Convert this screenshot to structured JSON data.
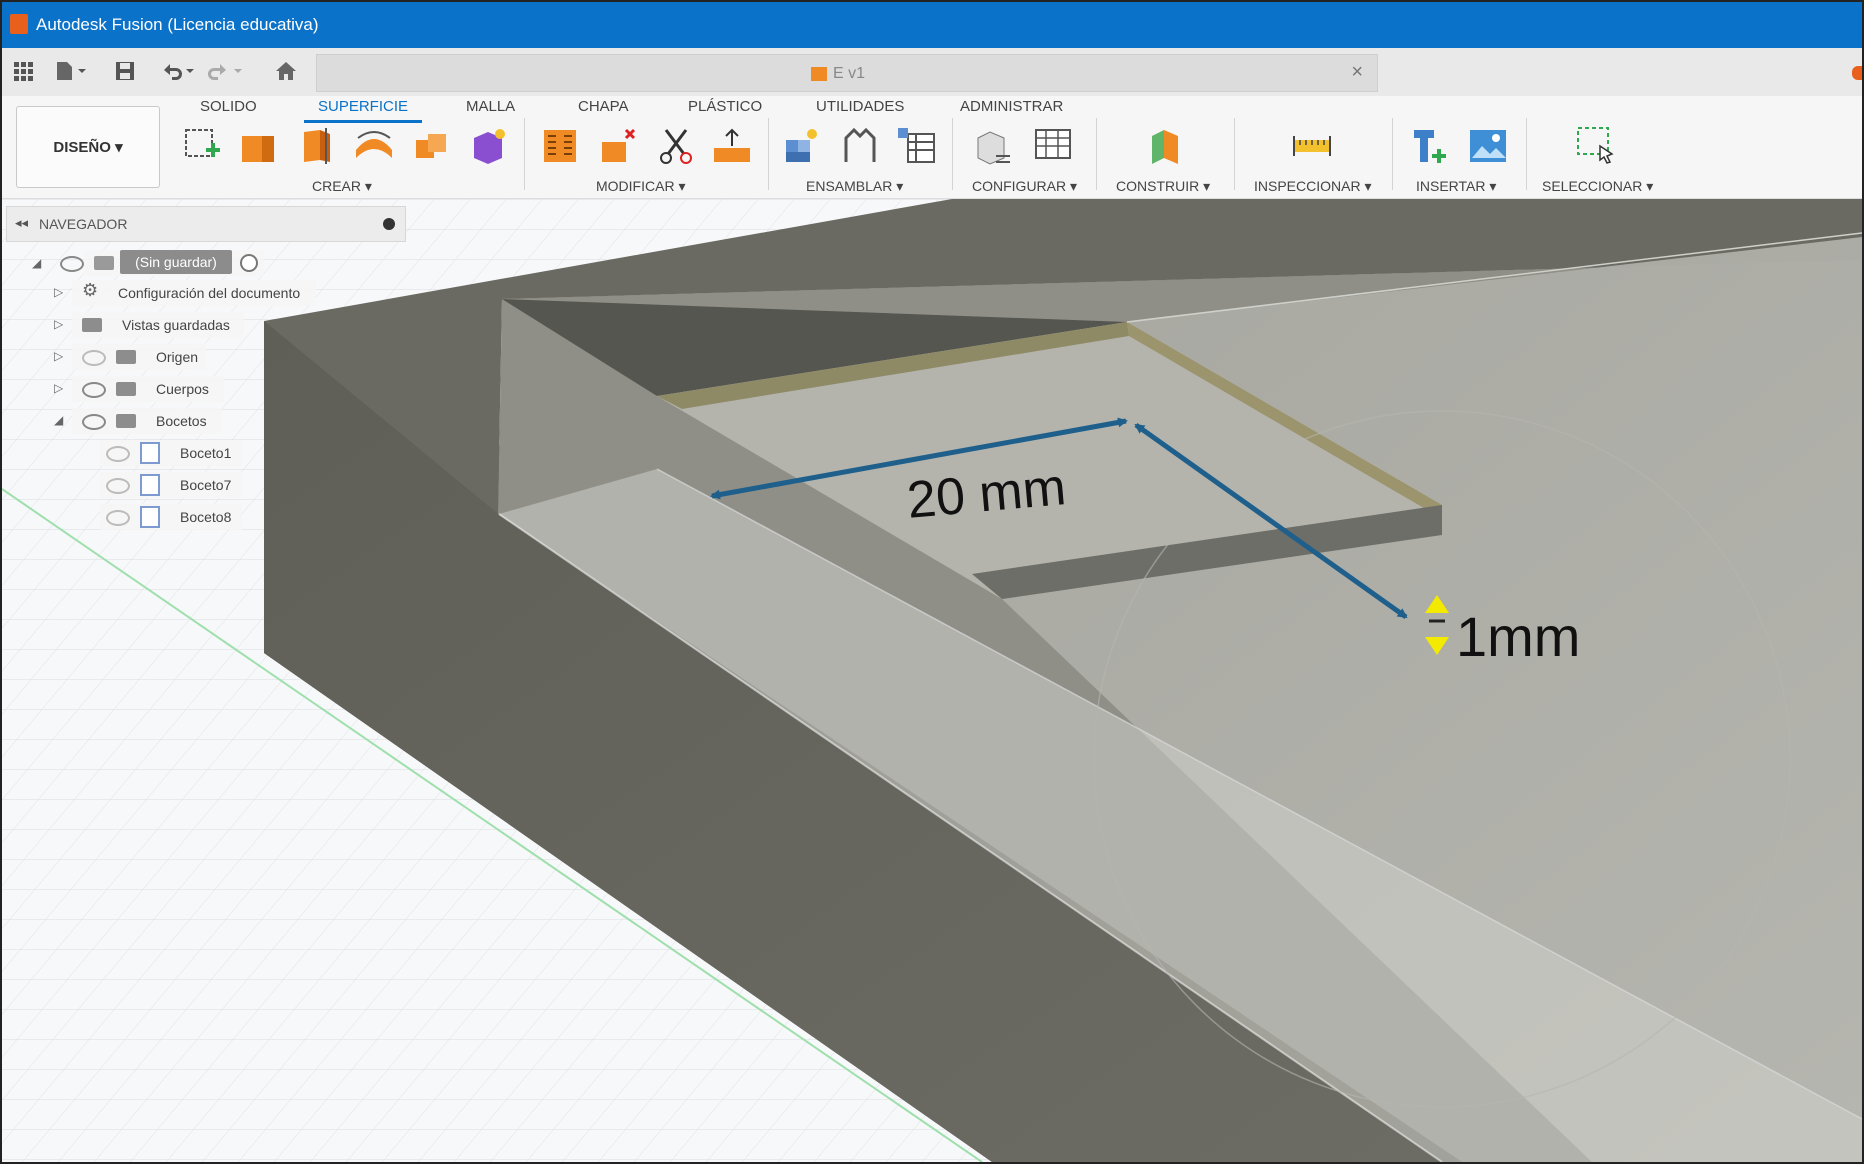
{
  "window": {
    "title": "Autodesk Fusion (Licencia educativa)"
  },
  "document_tab": {
    "name": "E v1",
    "close": "×"
  },
  "workspace": {
    "label": "DISEÑO ▾"
  },
  "ribbon": {
    "tabs": [
      {
        "label": "SOLIDO",
        "active": false
      },
      {
        "label": "SUPERFICIE",
        "active": true
      },
      {
        "label": "MALLA",
        "active": false
      },
      {
        "label": "CHAPA",
        "active": false
      },
      {
        "label": "PLÁSTICO",
        "active": false
      },
      {
        "label": "UTILIDADES",
        "active": false
      },
      {
        "label": "ADMINISTRAR",
        "active": false
      }
    ],
    "groups": [
      {
        "label": "CREAR ▾"
      },
      {
        "label": "MODIFICAR ▾"
      },
      {
        "label": "ENSAMBLAR ▾"
      },
      {
        "label": "CONFIGURAR ▾"
      },
      {
        "label": "CONSTRUIR ▾"
      },
      {
        "label": "INSPECCIONAR ▾"
      },
      {
        "label": "INSERTAR ▾"
      },
      {
        "label": "SELECCIONAR ▾"
      }
    ]
  },
  "navigator": {
    "title": "NAVEGADOR",
    "root": "(Sin guardar)",
    "items": [
      {
        "label": "Configuración del documento"
      },
      {
        "label": "Vistas guardadas"
      },
      {
        "label": "Origen"
      },
      {
        "label": "Cuerpos"
      },
      {
        "label": "Bocetos"
      },
      {
        "label": "Boceto1"
      },
      {
        "label": "Boceto7"
      },
      {
        "label": "Boceto8"
      }
    ]
  },
  "annotations": {
    "width": "20 mm",
    "depth": "1mm"
  },
  "colors": {
    "titlebar": "#0a72c9",
    "accent": "#0a72c9",
    "dimension_arrow": "#1f5f8b",
    "depth_marker": "#f3ea00",
    "body_side": "#66665f",
    "body_top": "#a6a69f",
    "pocket_floor": "#8f8a66"
  }
}
